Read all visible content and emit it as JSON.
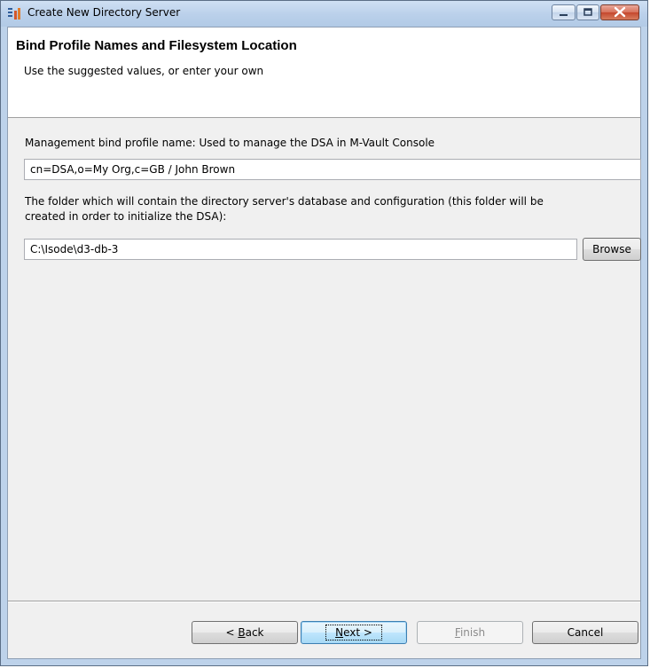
{
  "window": {
    "title": "Create New Directory Server",
    "icons": [
      "app-icon",
      "minimize-icon",
      "maximize-icon",
      "close-icon"
    ]
  },
  "header": {
    "title": "Bind Profile Names and Filesystem Location",
    "subtitle": "Use the suggested values, or enter your own"
  },
  "form": {
    "bind_label": "Management bind profile name: Used to manage the DSA in M-Vault Console",
    "bind_value": "cn=DSA,o=My Org,c=GB / John Brown",
    "folder_label_line1": "The folder which will contain the directory server's database and configuration (this folder will be",
    "folder_label_line2": "created in order to initialize the DSA):",
    "folder_value": "C:\\Isode\\d3-db-3",
    "browse_label": "Browse"
  },
  "footer": {
    "back_prefix": "< ",
    "back_mnemonic": "B",
    "back_rest": "ack",
    "next_mnemonic": "N",
    "next_rest": "ext >",
    "finish_mnemonic": "F",
    "finish_rest": "inish",
    "cancel_label": "Cancel"
  },
  "colors": {
    "titlebar": "#bad0ea",
    "content": "#f0f0f0",
    "default_button": "#bee6fd"
  }
}
